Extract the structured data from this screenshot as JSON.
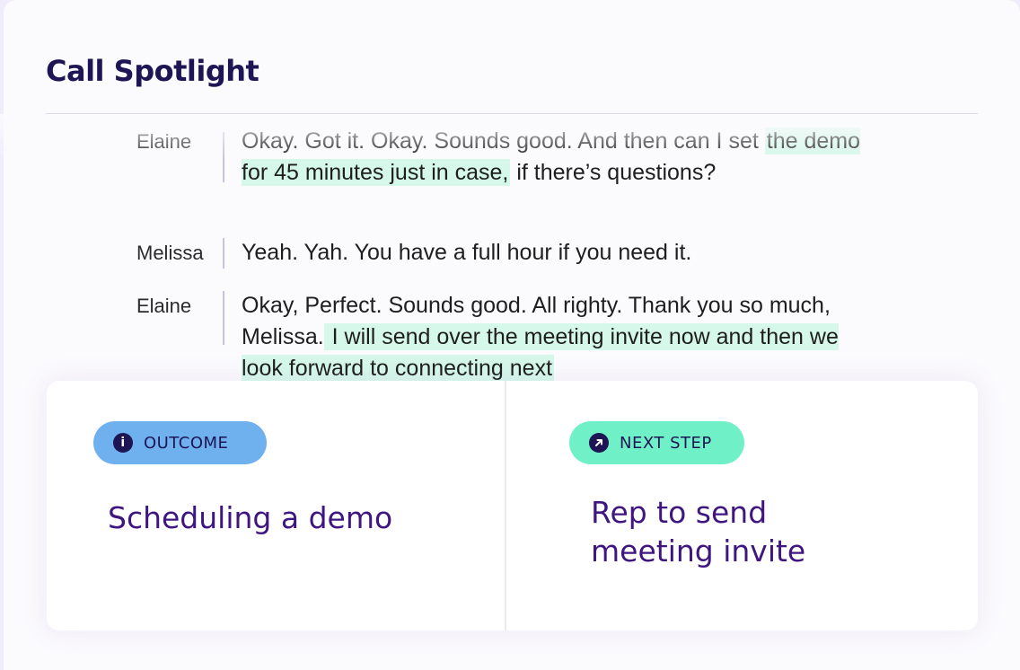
{
  "title": "Call Spotlight",
  "transcript": [
    {
      "speaker": "Elaine",
      "parts": [
        {
          "text": "Okay. Got it. Okay. Sounds good. And then can I set ",
          "highlight": false
        },
        {
          "text": "the demo for 45 minutes just in case,",
          "highlight": true
        },
        {
          "text": " if there’s questions?",
          "highlight": false
        }
      ]
    },
    {
      "speaker": "Melissa",
      "parts": [
        {
          "text": "Yeah. Yah. You have a full hour if you need it.",
          "highlight": false
        }
      ]
    },
    {
      "speaker": "Elaine",
      "parts": [
        {
          "text": "Okay, Perfect. Sounds good. All righty. Thank you so much, Melissa.",
          "highlight": false
        },
        {
          "text": " I will send over the meeting invite now and then we look forward to connecting next",
          "highlight": true
        }
      ]
    }
  ],
  "outcome": {
    "badge": "OUTCOME",
    "icon": "info-icon",
    "text": "Scheduling a demo"
  },
  "next_step": {
    "badge": "NEXT STEP",
    "icon": "arrow-up-right-icon",
    "text": "Rep to send meeting invite"
  },
  "colors": {
    "title": "#1d1554",
    "highlight": "#d6f8ea",
    "outcome_badge": "#6fb0ef",
    "next_step_badge": "#6ff0c7",
    "summary_text": "#3f1680"
  }
}
